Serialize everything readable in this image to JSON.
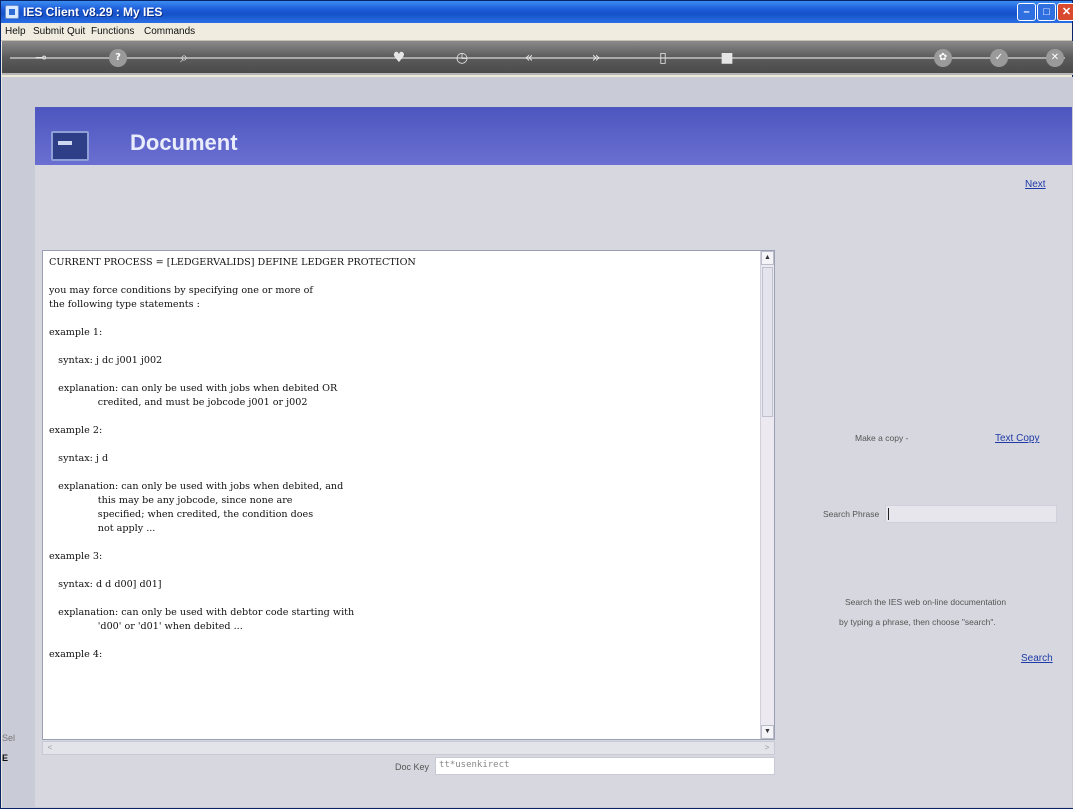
{
  "window": {
    "title": "IES Client v8.29 : My IES",
    "controls": {
      "minimize": "–",
      "maximize": "□",
      "close": "✕"
    }
  },
  "menubar": {
    "items": [
      "Help",
      "Submit",
      "Quit",
      "Functions",
      "Commands"
    ]
  },
  "toolbar": {
    "icons": [
      "key-icon",
      "help-icon",
      "search-icon",
      "heart-icon",
      "history-icon",
      "back-icon",
      "forward-icon",
      "document-icon",
      "stop-icon",
      "settings-icon",
      "check-icon",
      "close-icon"
    ],
    "glyphs": {
      "key": "⊸",
      "help": "?",
      "search": "⌕",
      "heart": "♥",
      "history": "◷",
      "back": "«",
      "forward": "»",
      "doc": "▯",
      "stop": "■",
      "settings": "✿",
      "check": "✓",
      "close": "✕"
    }
  },
  "banner": {
    "title": "Document"
  },
  "links": {
    "next": "Next",
    "text_copy": "Text Copy",
    "search": "Search"
  },
  "copy": {
    "label": "Make a copy -"
  },
  "search": {
    "label": "Search Phrase",
    "value": "",
    "help_line1": "Search the IES web on-line documentation",
    "help_line2": "by typing a phrase, then choose \"search\"."
  },
  "document": {
    "text": "CURRENT PROCESS = [LEDGERVALIDS] DEFINE LEDGER PROTECTION\n\nyou may force conditions by specifying one or more of\nthe following type statements :\n\nexample 1:\n\n   syntax: j dc j001 j002\n\n   explanation: can only be used with jobs when debited OR\n                credited, and must be jobcode j001 or j002\n\nexample 2:\n\n   syntax: j d\n\n   explanation: can only be used with jobs when debited, and\n                this may be any jobcode, since none are\n                specified; when credited, the condition does\n                not apply ...\n\nexample 3:\n\n   syntax: d d d00] d01]\n\n   explanation: can only be used with debtor code starting with\n                'd00' or 'd01' when debited ...\n\nexample 4:"
  },
  "scroll": {
    "up": "▲",
    "down": "▼",
    "left": "<",
    "right": ">"
  },
  "doc_key": {
    "label": "Doc Key",
    "value": "tt*usenkirect"
  },
  "side": {
    "sel_fragment": "Sel",
    "e_fragment": "E"
  },
  "colors": {
    "banner": "#5a60c8",
    "panel": "#d7d8df",
    "link": "#1e3aa8",
    "toolbar": "#5c5c5c"
  }
}
